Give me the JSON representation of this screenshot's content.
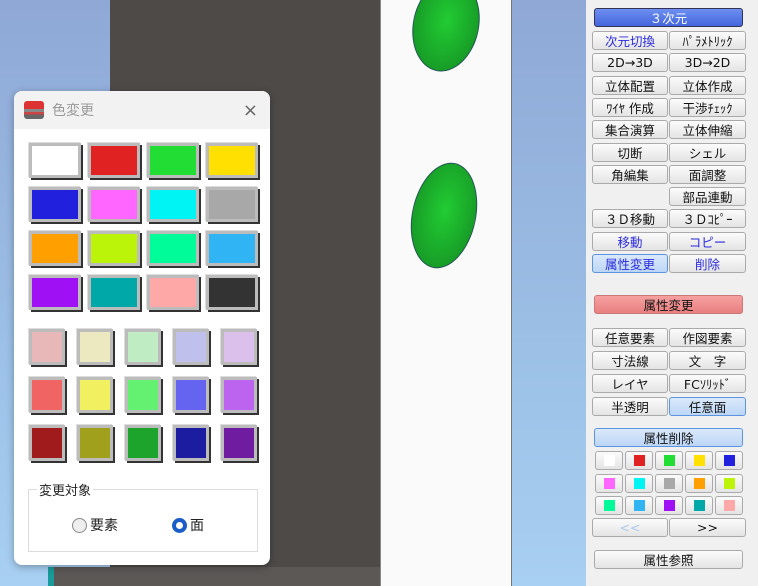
{
  "dialog": {
    "title": "色変更",
    "close": "×",
    "group_label": "変更対象",
    "radio_element": "要素",
    "radio_face": "面",
    "selected": "面",
    "primary_colors": [
      "#ffffff",
      "#e02222",
      "#22dd33",
      "#ffe000",
      "#2020dd",
      "#ff66ff",
      "#00f4f4",
      "#a8a8a8",
      "#ffa000",
      "#bbf408",
      "#00fc98",
      "#30b4f4",
      "#a010f4",
      "#00a8a8",
      "#ffa8a8",
      "#333333"
    ],
    "secondary_colors": [
      "#e8b8b8",
      "#ece8c0",
      "#c0ecc4",
      "#c0c0ec",
      "#dcc0ec",
      "#f06464",
      "#f0f060",
      "#64f070",
      "#6464f0",
      "#bc64f0",
      "#a01c1c",
      "#a0a01c",
      "#1ca42c",
      "#1c1ca0",
      "#701ca0"
    ]
  },
  "panel": {
    "mode": "３次元",
    "rows": [
      [
        "次元切換",
        "ﾊﾟﾗﾒﾄﾘｯｸ"
      ],
      [
        "2D→3D",
        "3D→2D"
      ],
      [
        "立体配置",
        "立体作成"
      ],
      [
        "ﾜｲﾔ 作成",
        "干渉ﾁｪｯｸ"
      ],
      [
        "集合演算",
        "立体伸縮"
      ],
      [
        "切断",
        "シェル"
      ],
      [
        "角編集",
        "面調整"
      ],
      [
        "",
        "部品連動"
      ],
      [
        "３Ｄ移動",
        "３Ｄｺﾋﾟｰ"
      ],
      [
        "移動",
        "コピー"
      ],
      [
        "属性変更",
        "削除"
      ]
    ],
    "attr_change": "属性変更",
    "attr_rows": [
      [
        "任意要素",
        "作図要素"
      ],
      [
        "寸法線",
        "文　字"
      ],
      [
        "レイヤ",
        "FCｿﾘｯﾄﾞ"
      ],
      [
        "半透明",
        "任意面"
      ]
    ],
    "attr_delete": "属性削除",
    "delete_colors": [
      "#ffffff",
      "#e02222",
      "#22dd33",
      "#ffe000",
      "#2020dd",
      "#ff66ff",
      "#00f4f4",
      "#a8a8a8",
      "#ffa000",
      "#bbf408",
      "#00fc98",
      "#30b4f4",
      "#a010f4",
      "#00a8a8",
      "#ffa8a8"
    ],
    "prev": "<<",
    "next": ">>",
    "attr_ref": "属性参照"
  }
}
